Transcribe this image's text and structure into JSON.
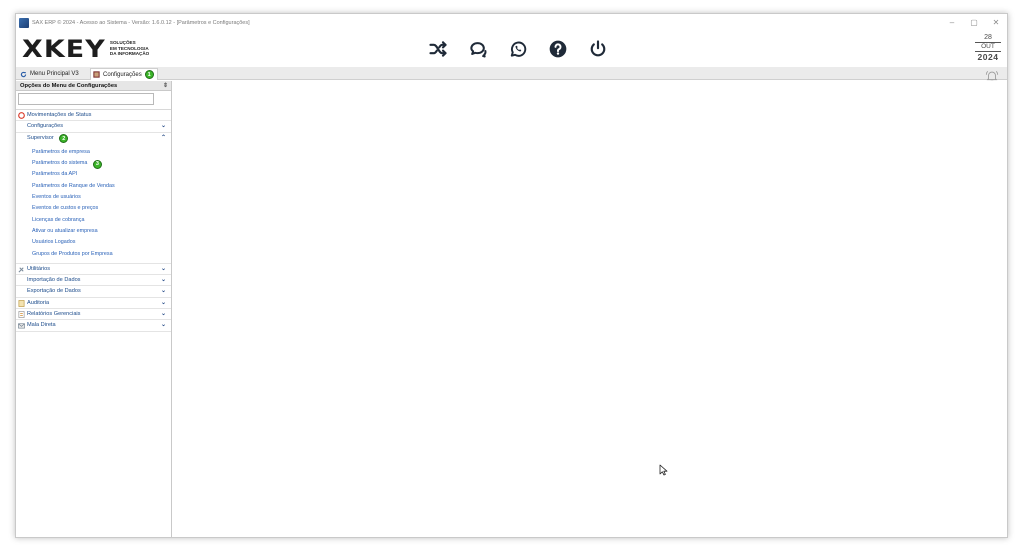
{
  "window": {
    "title": "SAX ERP © 2024 - Acesso ao Sistema - Versão: 1.6.0.12 - [Parâmetros e Configurações]",
    "controls": {
      "minimize": "–",
      "restore": "▢",
      "close": "✕"
    }
  },
  "header": {
    "logo_mark": "XKEY",
    "logo_tag_line1": "SOLUÇÕES",
    "logo_tag_line2": "EM TECNOLOGIA",
    "logo_tag_line3": "DA INFORMAÇÃO",
    "toolbar_icons": [
      "shuffle-icon",
      "chat-icon",
      "whatsapp-icon",
      "help-icon",
      "power-icon"
    ],
    "date": {
      "day": "28",
      "month": "OUT",
      "year": "2024"
    }
  },
  "tabs": [
    {
      "label": "Menu Principal V3",
      "icon": "refresh-icon"
    },
    {
      "label": "Configurações",
      "icon": "settings-icon",
      "badge": "1",
      "active": true
    }
  ],
  "panel": {
    "title": "Opções do Menu de Configurações",
    "pin": "⇕",
    "filter_value": "",
    "sections": [
      {
        "label": "Movimentações de Status",
        "icon": "status-icon"
      },
      {
        "label": "Configurações",
        "chevron": "⌄"
      },
      {
        "label": "Supervisor",
        "chevron": "⌃",
        "badge": "2",
        "expanded": true
      },
      {
        "label": "Utilitários",
        "icon": "tools-icon",
        "chevron": "⌄"
      },
      {
        "label": "Importação de Dados",
        "chevron": "⌄"
      },
      {
        "label": "Exportação de Dados",
        "chevron": "⌄"
      },
      {
        "label": "Auditoria",
        "icon": "audit-icon",
        "chevron": "⌄"
      },
      {
        "label": "Relatórios Gerenciais",
        "icon": "report-icon",
        "chevron": "⌄"
      },
      {
        "label": "Mala Direta",
        "icon": "mail-icon",
        "chevron": "⌄"
      }
    ],
    "supervisor_items": [
      "Parâmetros de empresa",
      "Parâmetros do sistema",
      "Parâmetros da API",
      "Parâmetros de Ranque de Vendas",
      "Eventos de usuários",
      "Eventos de custos e preços",
      "Licenças de cobrança",
      "Ativar ou atualizar empresa",
      "Usuários Logados",
      "Grupos de Produtos por Empresa"
    ],
    "supervisor_item_badge": "3"
  },
  "colors": {
    "accent_link": "#2a62b8",
    "badge_green": "#3cb529",
    "status_red": "#d93a2b",
    "tab_bar": "#ebebeb"
  }
}
